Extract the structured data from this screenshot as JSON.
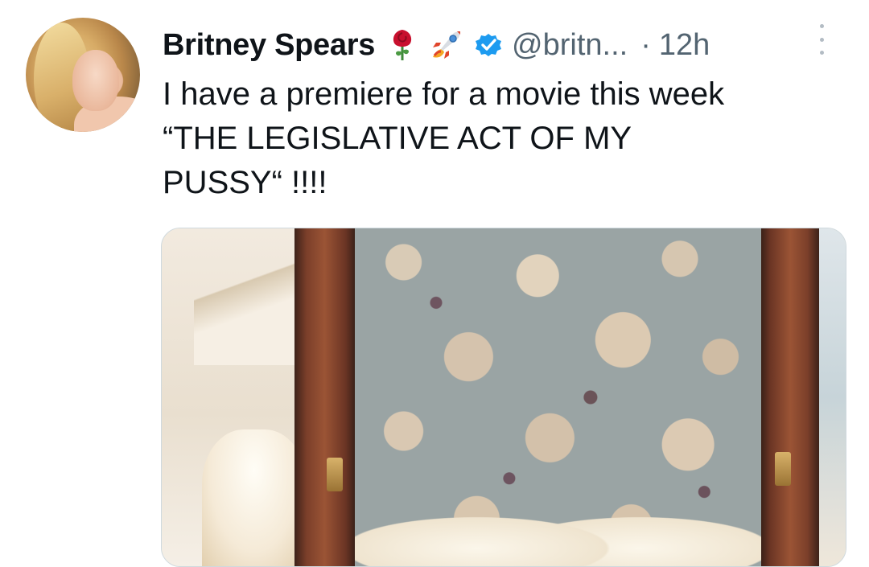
{
  "tweet": {
    "author_name": "Britney Spears",
    "author_emojis": [
      "rose-icon",
      "rocket-icon"
    ],
    "verified": true,
    "handle": "@britn...",
    "separator": "·",
    "time": "12h",
    "text": "I have a premiere for a movie this week\n“THE LEGISLATIVE ACT OF MY\nPUSSY“ !!!!",
    "media": "photo"
  },
  "colors": {
    "text_primary": "#0f1419",
    "text_secondary": "#536471",
    "verified_blue": "#1d9bf0",
    "media_border": "#cfd9de"
  }
}
